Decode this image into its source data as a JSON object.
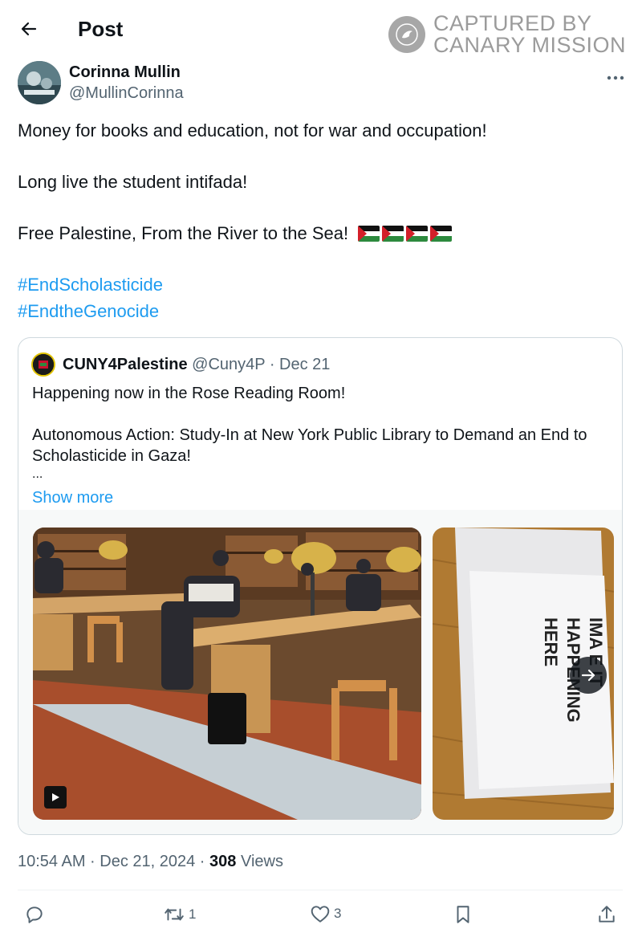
{
  "header": {
    "title": "Post"
  },
  "watermark": {
    "line1": "CAPTURED BY",
    "line2": "CANARY MISSION"
  },
  "author": {
    "name": "Corinna Mullin",
    "handle": "@MullinCorinna"
  },
  "post": {
    "line1": "Money for books and education, not for war and occupation!",
    "line2": "Long live the student intifada!",
    "line3": "Free Palestine, From the River to the Sea!",
    "flag_emoji_count": 4,
    "hashtag1": "#EndScholasticide",
    "hashtag2": "#EndtheGenocide"
  },
  "quoted_post": {
    "name": "CUNY4Palestine",
    "meta": " @Cuny4P · Dec 21",
    "line1": "Happening now in the Rose Reading Room!",
    "line2": "Autonomous Action: Study-In at New York Public Library to Demand an End to",
    "line3": "Scholasticide in Gaza!",
    "ellipsis": "...",
    "show_more": "Show more",
    "media2_sign_text_line1": "IMA E IT",
    "media2_sign_text_line2": "HAPPENING",
    "media2_sign_text_line3": "HERE"
  },
  "timestamp": {
    "time": "10:54 AM · Dec 21, 2024 · ",
    "views_count": "308",
    "views_label": " Views"
  },
  "actions": {
    "reply_count": "",
    "repost_count": "1",
    "like_count": "3"
  },
  "colors": {
    "link": "#1d9bf0",
    "text": "#0f1419",
    "muted": "#536471",
    "border": "#cfd9de"
  },
  "icons": [
    "back-arrow-icon",
    "more-icon",
    "play-icon",
    "arrow-right-icon",
    "reply-icon",
    "repost-icon",
    "like-icon",
    "bookmark-icon",
    "share-icon",
    "canary-logo-icon"
  ]
}
